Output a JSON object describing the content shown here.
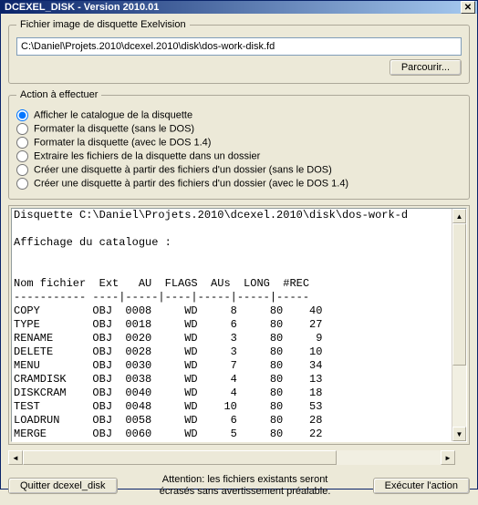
{
  "window": {
    "title": "DCEXEL_DISK - Version 2010.01"
  },
  "group_file": {
    "legend": "Fichier image de disquette Exelvision",
    "path": "C:\\Daniel\\Projets.2010\\dcexel.2010\\disk\\dos-work-disk.fd",
    "browse_label": "Parcourir..."
  },
  "group_action": {
    "legend": "Action à effectuer",
    "options": [
      "Afficher le catalogue de la disquette",
      "Formater la disquette (sans le DOS)",
      "Formater la disquette (avec le DOS 1.4)",
      "Extraire les fichiers de la disquette dans un dossier",
      "Créer une disquette à partir des fichiers d'un dossier (sans le DOS)",
      "Créer une disquette à partir des fichiers d'un dossier (avec le DOS 1.4)"
    ],
    "selected_index": 0
  },
  "output": {
    "header1": "Disquette C:\\Daniel\\Projets.2010\\dcexel.2010\\disk\\dos-work-d",
    "header2": "Affichage du catalogue :",
    "col_header": "Nom fichier  Ext   AU  FLAGS  AUs  LONG  #REC",
    "divider": "----------- ----|-----|----|-----|-----|-----",
    "rows": [
      {
        "name": "COPY",
        "ext": "OBJ",
        "au": "0008",
        "flags": "WD",
        "aus": 8,
        "long": 80,
        "rec": 40
      },
      {
        "name": "TYPE",
        "ext": "OBJ",
        "au": "0018",
        "flags": "WD",
        "aus": 6,
        "long": 80,
        "rec": 27
      },
      {
        "name": "RENAME",
        "ext": "OBJ",
        "au": "0020",
        "flags": "WD",
        "aus": 3,
        "long": 80,
        "rec": 9
      },
      {
        "name": "DELETE",
        "ext": "OBJ",
        "au": "0028",
        "flags": "WD",
        "aus": 3,
        "long": 80,
        "rec": 10
      },
      {
        "name": "MENU",
        "ext": "OBJ",
        "au": "0030",
        "flags": "WD",
        "aus": 7,
        "long": 80,
        "rec": 34
      },
      {
        "name": "CRAMDISK",
        "ext": "OBJ",
        "au": "0038",
        "flags": "WD",
        "aus": 4,
        "long": 80,
        "rec": 13
      },
      {
        "name": "DISKCRAM",
        "ext": "OBJ",
        "au": "0040",
        "flags": "WD",
        "aus": 4,
        "long": 80,
        "rec": 18
      },
      {
        "name": "TEST",
        "ext": "OBJ",
        "au": "0048",
        "flags": "WD",
        "aus": 10,
        "long": 80,
        "rec": 53
      },
      {
        "name": "LOADRUN",
        "ext": "OBJ",
        "au": "0058",
        "flags": "WD",
        "aus": 6,
        "long": 80,
        "rec": 28
      },
      {
        "name": "MERGE",
        "ext": "OBJ",
        "au": "0060",
        "flags": "WD",
        "aus": 5,
        "long": 80,
        "rec": 22
      }
    ]
  },
  "footer": {
    "quit_label": "Quitter dcexel_disk",
    "warn_line1": "Attention: les fichiers existants seront",
    "warn_line2": "écrasés sans avertissement préalable.",
    "exec_label": "Exécuter l'action"
  }
}
